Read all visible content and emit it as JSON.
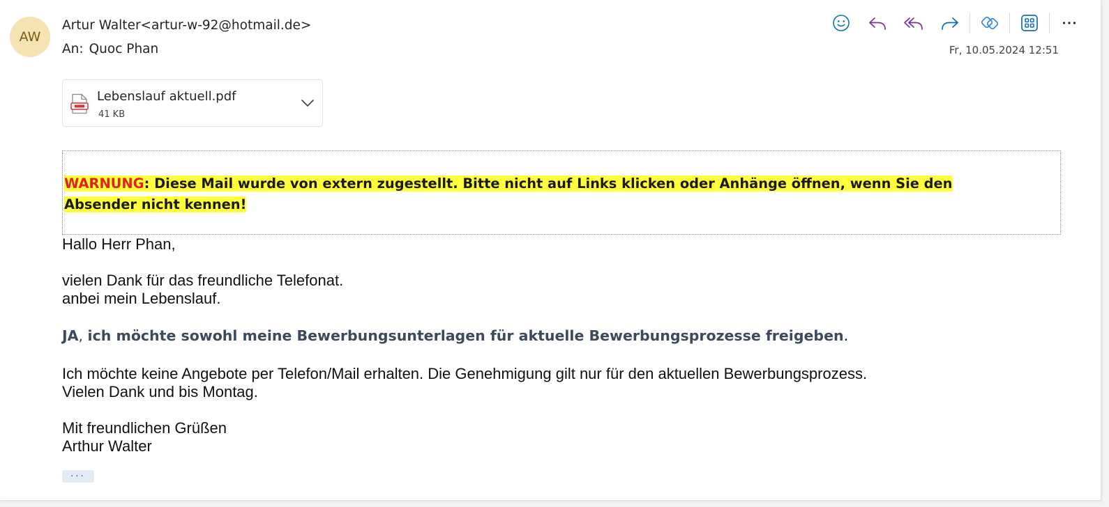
{
  "sender": {
    "initials": "AW",
    "display": "Artur Walter<artur-w-92@hotmail.de>"
  },
  "recipient": {
    "label": "An:",
    "name": "Quoc Phan"
  },
  "date": "Fr, 10.05.2024 12:51",
  "toolbar": {
    "icons": [
      "emoji-icon",
      "reply-icon",
      "reply-all-icon",
      "forward-icon",
      "viva-insights-icon",
      "apps-icon",
      "more-icon"
    ],
    "more_label": "···"
  },
  "attachment": {
    "name": "Lebenslauf aktuell.pdf",
    "size": "41 KB",
    "icon": "pdf-file-icon"
  },
  "warning": {
    "keyword": "WARNUNG",
    "text": ": Diese Mail wurde von extern zugestellt. Bitte nicht auf Links klicken oder Anhänge öffnen, wenn Sie den Absender nicht kennen!"
  },
  "body": {
    "greeting": "Hallo Herr Phan,",
    "line1": "vielen Dank für das freundliche Telefonat.",
    "line2": "anbei mein Lebenslauf.",
    "consent_ja": "JA",
    "consent_comma": ", ",
    "consent_text": "ich möchte sowohl meine Bewerbungsunterlagen für aktuelle Bewerbungsprozesse freigeben",
    "consent_period": ".",
    "line3": "Ich möchte keine Angebote per Telefon/Mail erhalten. Die Genehmigung gilt nur für den aktuellen Bewerbungsprozess.",
    "line4": "Vielen Dank und bis Montag.",
    "closing": "Mit freundlichen Grüßen",
    "signature": "Arthur Walter"
  },
  "expand_label": "···",
  "colors": {
    "avatar_bg": "#f6e3b4",
    "warning_highlight": "#ffff3d",
    "warning_keyword": "#e5201e",
    "accent_blue": "#0f6cbd",
    "accent_purple": "#7a2f9c"
  }
}
